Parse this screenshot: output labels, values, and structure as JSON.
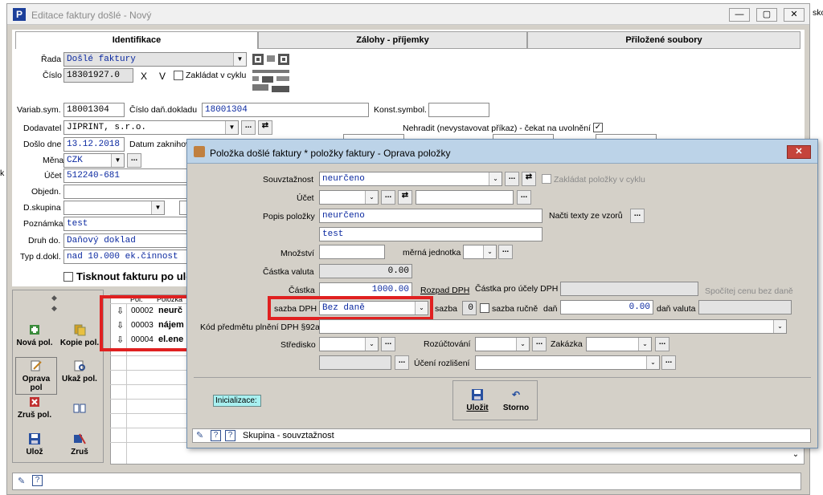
{
  "main": {
    "title": "Editace faktury došlé - Nový",
    "tabs": [
      "Identifikace",
      "Zálohy - příjemky",
      "Přiložené soubory"
    ],
    "rada_label": "Řada",
    "rada_value": "Došlé faktury",
    "cislo_label": "Číslo",
    "cislo_value": "18301927.0",
    "x_label": "X",
    "v_label": "V",
    "zakladat_label": "Zakládat v cyklu",
    "variab_label": "Variab.sym.",
    "variab_value": "18001304",
    "cislo_dan_label": "Číslo daň.dokladu",
    "cislo_dan_value": "18001304",
    "konst_label": "Konst.symbol.",
    "dodavatel_label": "Dodavatel",
    "dodavatel_value": "JIPRINT, s.r.o.",
    "nehradit_label": "Nehradit (nevystavovat příkaz) - čekat na uvolnění",
    "doslo_label": "Došlo dne",
    "doslo_value": "13.12.2018",
    "datum_label": "Datum zaknihov",
    "mena_label": "Měna",
    "mena_value": "CZK",
    "ucet_label": "Účet",
    "ucet_value": "512240-681",
    "objedn_label": "Objedn.",
    "dskupina_label": "D.skupina",
    "poznamka_label": "Poznámka",
    "poznamka_value": "test",
    "druh_label": "Druh do.",
    "druh_value": "Daňový doklad",
    "typ_label": "Typ d.dokl.",
    "typ_value": "nad 10.000 ek.činnost",
    "tisknout_label": "Tisknout fakturu po ulo",
    "side_buttons": [
      "Nová pol.",
      "Kopie pol.",
      "Oprava pol",
      "Ukaž pol.",
      "Zruš pol.",
      "Ulož",
      "Zruš"
    ],
    "table_headers": [
      "Pol.",
      "Položka"
    ],
    "table_rows": [
      {
        "pol": "00002",
        "item": "neurč"
      },
      {
        "pol": "00003",
        "item": "nájem"
      },
      {
        "pol": "00004",
        "item": "el.ene"
      }
    ],
    "right_edge_texts": [
      "sko"
    ],
    "left_edge_text": "k"
  },
  "dialog": {
    "title": "Položka došlé faktury * položky faktury - Oprava položky",
    "souvztaznost_label": "Souvztažnost",
    "souvztaznost_value": "neurčeno",
    "zakladat_polozky_label": "Zakládat položky v cyklu",
    "ucet_label": "Účet",
    "popis_label": "Popis položky",
    "popis_value1": "neurčeno",
    "popis_value2": "test",
    "nacti_label": "Načti texty ze vzorů",
    "mnozstvi_label": "Množství",
    "merna_label": "měrná jednotka",
    "castka_valuta_label": "Částka valuta",
    "castka_valuta_value": "0.00",
    "castka_label": "Částka",
    "castka_value": "1000.00",
    "rozpad_label": "Rozpad DPH",
    "castka_dph_label": "Částka pro účely DPH",
    "spocitej_label": "Spočítej cenu bez daně",
    "sazba_dph_label": "sazba DPH",
    "sazba_dph_value": "Bez daně",
    "sazba_label": "sazba",
    "sazba_value": "0",
    "sazba_rucne_label": "sazba ručně",
    "dan_label": "daň",
    "dan_value": "0.00",
    "dan_valuta_label": "daň valuta",
    "kod_label": "Kód předmětu plnění DPH §92a",
    "stredisko_label": "Středisko",
    "rozuctovani_label": "Rozúčtování",
    "zakazka_label": "Zakázka",
    "uceni_label": "Účení rozlišení",
    "inicializace_label": "Inicializace:",
    "ulozit_label": "Uložit",
    "storno_label": "Storno",
    "status_text": "Skupina - souvztažnost"
  },
  "colors": {
    "red_highlight": "#e02020",
    "field_text": "#0a28a0",
    "dialog_title_bg": "#bcd3e8"
  }
}
